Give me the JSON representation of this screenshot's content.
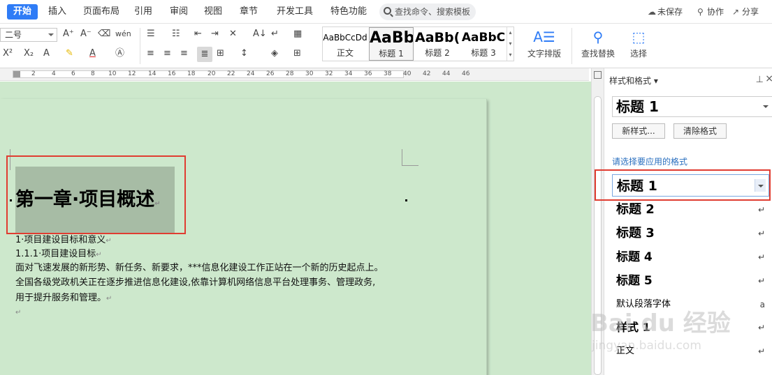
{
  "tabs": [
    {
      "label": "开始",
      "active": true
    },
    {
      "label": "插入"
    },
    {
      "label": "页面布局"
    },
    {
      "label": "引用"
    },
    {
      "label": "审阅"
    },
    {
      "label": "视图"
    },
    {
      "label": "章节"
    },
    {
      "label": "开发工具"
    },
    {
      "label": "特色功能"
    }
  ],
  "search_placeholder": "查找命令、搜索模板",
  "topbar": {
    "unsaved": "未保存",
    "collab": "协作",
    "share": "分享"
  },
  "ribbon": {
    "font_size": "二号",
    "styles": [
      {
        "preview": "AaBbCcDd",
        "label": "正文"
      },
      {
        "preview": "AaBb",
        "label": "标题 1",
        "selected": true
      },
      {
        "preview": "AaBb(",
        "label": "标题 2"
      },
      {
        "preview": "AaBbC",
        "label": "标题 3"
      }
    ],
    "text_layout": "文字排版",
    "find_replace": "查找替换",
    "select": "选择"
  },
  "ruler_ticks": [
    "2",
    "4",
    "6",
    "8",
    "10",
    "12",
    "14",
    "16",
    "18",
    "20",
    "22",
    "24",
    "26",
    "28",
    "30",
    "32",
    "34",
    "36",
    "38",
    "40",
    "42",
    "44",
    "46"
  ],
  "document": {
    "heading": "第一章·项目概述",
    "lines": [
      "1·项目建设目标和意义",
      "1.1.1·项目建设目标",
      "面对飞速发展的新形势、新任务、新要求，***信息化建设工作正站在一个新的历史起点上。",
      "全国各级党政机关正在逐步推进信息化建设,依靠计算机网络信息平台处理事务、管理政务,",
      "用于提升服务和管理。"
    ]
  },
  "panel": {
    "title": "样式和格式",
    "current_style": "标题  1",
    "new_style": "新样式...",
    "clear_format": "清除格式",
    "prompt": "请选择要应用的格式",
    "items": [
      {
        "label": "标题  1",
        "selected": true
      },
      {
        "label": "标题  2"
      },
      {
        "label": "标题  3"
      },
      {
        "label": "标题  4"
      },
      {
        "label": "标题  5"
      },
      {
        "label": "默认段落字体"
      },
      {
        "label": "样式 1"
      },
      {
        "label": "正文"
      }
    ]
  },
  "watermark": {
    "main": "Bai du 经验",
    "sub": "jingyan.baidu.com"
  }
}
